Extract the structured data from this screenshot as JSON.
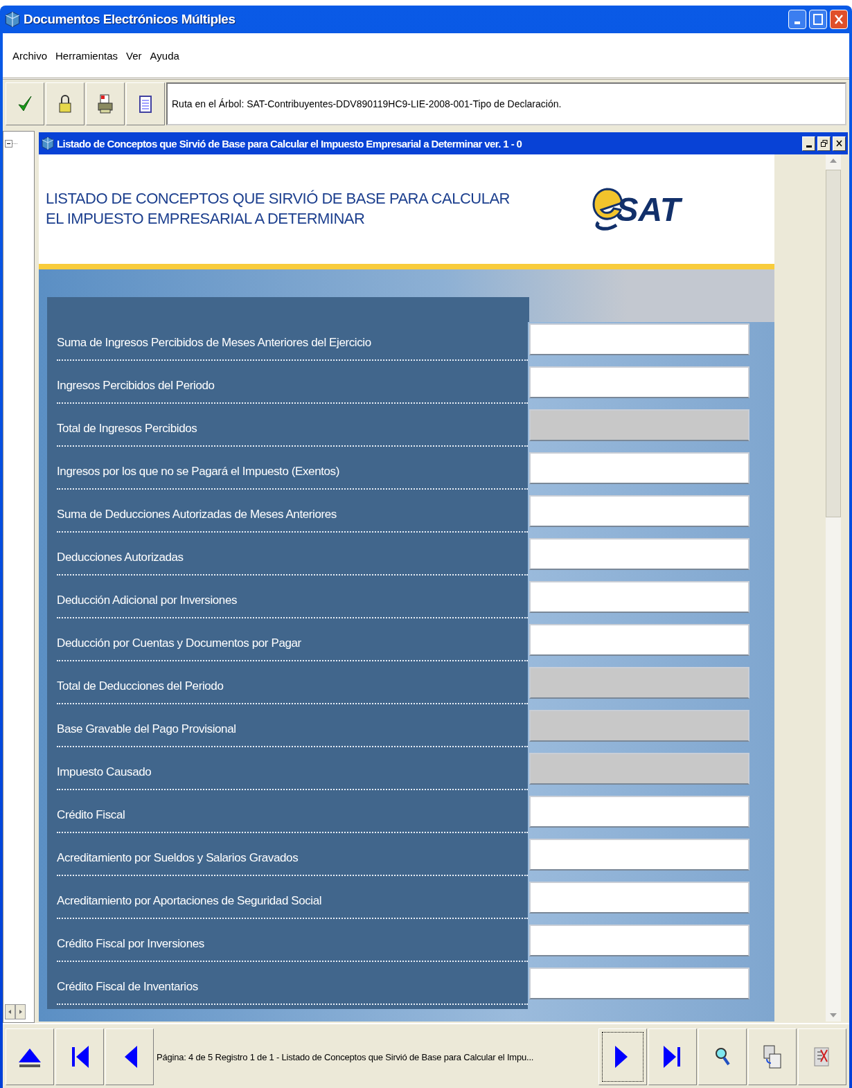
{
  "window": {
    "title": "Documentos Electrónicos Múltiples"
  },
  "menu": [
    "Archivo",
    "Herramientas",
    "Ver",
    "Ayuda"
  ],
  "toolbar": {
    "path": "Ruta en el Árbol: SAT-Contribuyentes-DDV890119HC9-LIE-2008-001-Tipo de Declaración."
  },
  "child_window": {
    "title": "Listado de Conceptos que Sirvió de Base para Calcular el Impuesto Empresarial a Determinar ver. 1 - 0"
  },
  "form": {
    "heading": "LISTADO DE CONCEPTOS QUE SIRVIÓ DE BASE PARA CALCULAR EL IMPUESTO EMPRESARIAL A DETERMINAR",
    "logo_text": "SAT",
    "fields": [
      {
        "label": "Suma de Ingresos Percibidos de Meses Anteriores del Ejercicio",
        "readonly": false
      },
      {
        "label": "Ingresos Percibidos del Periodo",
        "readonly": false
      },
      {
        "label": "Total de Ingresos Percibidos",
        "readonly": true
      },
      {
        "label": "Ingresos por los que no se Pagará el Impuesto (Exentos)",
        "readonly": false
      },
      {
        "label": "Suma de Deducciones Autorizadas de Meses Anteriores",
        "readonly": false
      },
      {
        "label": "Deducciones Autorizadas",
        "readonly": false
      },
      {
        "label": "Deducción Adicional por Inversiones",
        "readonly": false
      },
      {
        "label": "Deducción por Cuentas y Documentos por Pagar",
        "readonly": false
      },
      {
        "label": "Total de Deducciones del Periodo",
        "readonly": true
      },
      {
        "label": "Base Gravable del Pago Provisional",
        "readonly": true
      },
      {
        "label": "Impuesto Causado",
        "readonly": true
      },
      {
        "label": "Crédito Fiscal",
        "readonly": false
      },
      {
        "label": "Acreditamiento por Sueldos y Salarios Gravados",
        "readonly": false
      },
      {
        "label": "Acreditamiento por Aportaciones de Seguridad Social",
        "readonly": false
      },
      {
        "label": "Crédito Fiscal por Inversiones",
        "readonly": false
      },
      {
        "label": "Crédito Fiscal de Inventarios",
        "readonly": false
      }
    ]
  },
  "status": {
    "text": "Página: 4  de  5 Registro  1 de  1 -  Listado de Conceptos que Sirvió de Base para Calcular el Impu..."
  }
}
